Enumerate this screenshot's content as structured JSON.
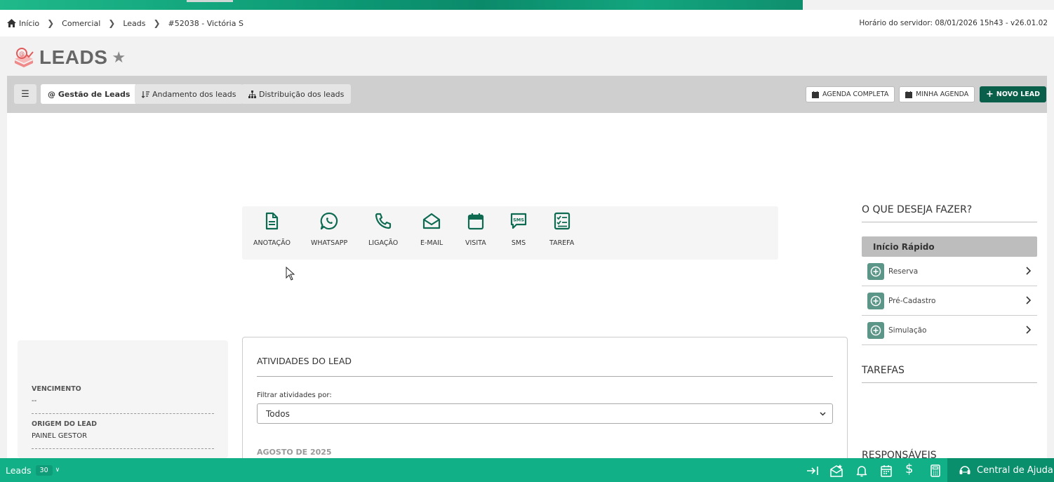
{
  "breadcrumb": [
    {
      "label": "Início"
    },
    {
      "label": "Comercial"
    },
    {
      "label": "Leads"
    },
    {
      "label": "#52038 - Victória S"
    }
  ],
  "server_time": "Horário do servidor: 08/01/2026 15h43 - v26.01.02",
  "page_title": "LEADS",
  "tabs": [
    {
      "label": "@ Gestão de Leads"
    },
    {
      "label": "Andamento dos leads"
    },
    {
      "label": "Distribuição dos leads"
    }
  ],
  "toolbar_right": {
    "agenda_completa": "AGENDA COMPLETA",
    "minha_agenda": "MINHA AGENDA",
    "novo_lead": "NOVO LEAD"
  },
  "actions": [
    {
      "label": "ANOTAÇÃO",
      "icon": "file-icon"
    },
    {
      "label": "WHATSAPP",
      "icon": "whatsapp-icon"
    },
    {
      "label": "LIGAÇÃO",
      "icon": "phone-icon"
    },
    {
      "label": "E-MAIL",
      "icon": "envelope-open-icon"
    },
    {
      "label": "VISITA",
      "icon": "calendar-icon"
    },
    {
      "label": "SMS",
      "icon": "sms-icon",
      "badge": "SMS"
    },
    {
      "label": "TAREFA",
      "icon": "checklist-icon"
    }
  ],
  "lead_info": {
    "vencimento_label": "VENCIMENTO",
    "vencimento_value": "--",
    "origem_label": "ORIGEM DO LEAD",
    "origem_value": "PAINEL GESTOR"
  },
  "activities": {
    "title": "ATIVIDADES DO LEAD",
    "filter_label": "Filtrar atividades por:",
    "filter_value": "Todos",
    "month": "AGOSTO DE 2025"
  },
  "right_panel": {
    "title": "O QUE DESEJA FAZER?",
    "quick_start": "Início Rápido",
    "items": [
      {
        "label": "Reserva"
      },
      {
        "label": "Pré-Cadastro"
      },
      {
        "label": "Simulação"
      }
    ],
    "tasks_title": "TAREFAS",
    "responsaveis_title": "RESPONSÁVEIS"
  },
  "bottom_bar": {
    "leads_label": "Leads",
    "leads_count": "30",
    "help_label": "Central de Ajuda"
  },
  "colors": {
    "brand": "#12b087",
    "brand_dark": "#0a5f4b",
    "icon_green": "#0e6b52"
  }
}
